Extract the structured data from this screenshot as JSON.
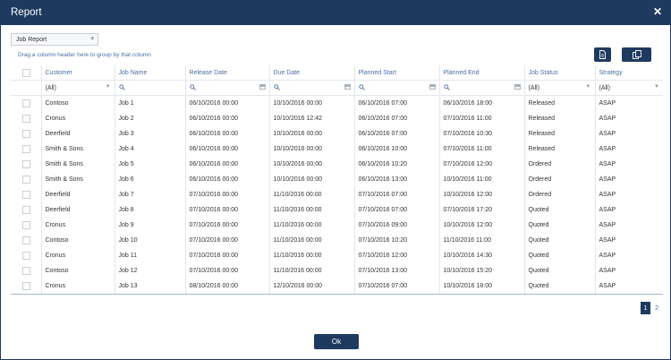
{
  "window": {
    "title": "Report",
    "close_glyph": "✕"
  },
  "report_select": {
    "value": "Job Report",
    "chevron": "▾"
  },
  "group_hint": "Drag a column header here to group by that column",
  "toolbar": {
    "icons": [
      "export-document-icon",
      "copy-icon"
    ]
  },
  "columns": [
    "Customer",
    "Job Name",
    "Release Date",
    "Due Date",
    "Planned Start",
    "Planned End",
    "Job Status",
    "Strategy"
  ],
  "filters": {
    "customer": "(All)",
    "job_status": "(All)",
    "strategy": "(All)"
  },
  "rows": [
    [
      "Contoso",
      "Job 1",
      "06/10/2016 00:00",
      "10/10/2016 00:00",
      "06/10/2016 07:00",
      "06/10/2016 18:00",
      "Released",
      "ASAP"
    ],
    [
      "Cronus",
      "Job 2",
      "06/10/2016 00:00",
      "10/10/2016 12:42",
      "06/10/2016 07:00",
      "07/10/2016 11:00",
      "Released",
      "ASAP"
    ],
    [
      "Deerfield",
      "Job 3",
      "06/10/2016 00:00",
      "10/10/2016 00:00",
      "06/10/2016 07:00",
      "07/10/2016 10:30",
      "Released",
      "ASAP"
    ],
    [
      "Smith & Sons",
      "Job 4",
      "06/10/2016 00:00",
      "10/10/2016 00:00",
      "06/10/2016 10:00",
      "07/10/2016 11:00",
      "Released",
      "ASAP"
    ],
    [
      "Smith & Sons",
      "Job 5",
      "06/10/2016 00:00",
      "10/10/2016 00:00",
      "06/10/2016 10:20",
      "07/10/2016 12:00",
      "Ordered",
      "ASAP"
    ],
    [
      "Smith & Sons",
      "Job 6",
      "06/10/2016 00:00",
      "10/10/2016 00:00",
      "06/10/2016 13:00",
      "10/10/2016 11:00",
      "Ordered",
      "ASAP"
    ],
    [
      "Deerfield",
      "Job 7",
      "07/10/2016 00:00",
      "11/10/2016 00:00",
      "07/10/2016 07:00",
      "10/10/2016 12:00",
      "Ordered",
      "ASAP"
    ],
    [
      "Deerfield",
      "Job 8",
      "07/10/2016 00:00",
      "11/10/2016 00:00",
      "07/10/2016 07:00",
      "07/10/2016 17:20",
      "Quoted",
      "ASAP"
    ],
    [
      "Cronus",
      "Job 9",
      "07/10/2016 00:00",
      "11/10/2016 00:00",
      "07/10/2016 09:00",
      "10/10/2016 12:00",
      "Quoted",
      "ASAP"
    ],
    [
      "Contoso",
      "Job 10",
      "07/10/2016 00:00",
      "11/10/2016 00:00",
      "07/10/2016 10:20",
      "11/10/2016 11:00",
      "Quoted",
      "ASAP"
    ],
    [
      "Cronus",
      "Job 11",
      "07/10/2016 00:00",
      "11/10/2016 00:00",
      "07/10/2016 12:00",
      "10/10/2016 14:30",
      "Quoted",
      "ASAP"
    ],
    [
      "Contoso",
      "Job 12",
      "07/10/2016 00:00",
      "11/10/2016 00:00",
      "07/10/2016 13:00",
      "10/10/2016 15:20",
      "Quoted",
      "ASAP"
    ],
    [
      "Cronus",
      "Job 13",
      "08/10/2016 00:00",
      "12/10/2016 00:00",
      "07/10/2016 07:00",
      "10/10/2016 18:00",
      "Quoted",
      "ASAP"
    ]
  ],
  "pager": {
    "pages": [
      "1",
      "2"
    ],
    "current": "1"
  },
  "ok_label": "Ok",
  "colors": {
    "accent": "#1f3a5f",
    "link": "#4a6fa5"
  }
}
